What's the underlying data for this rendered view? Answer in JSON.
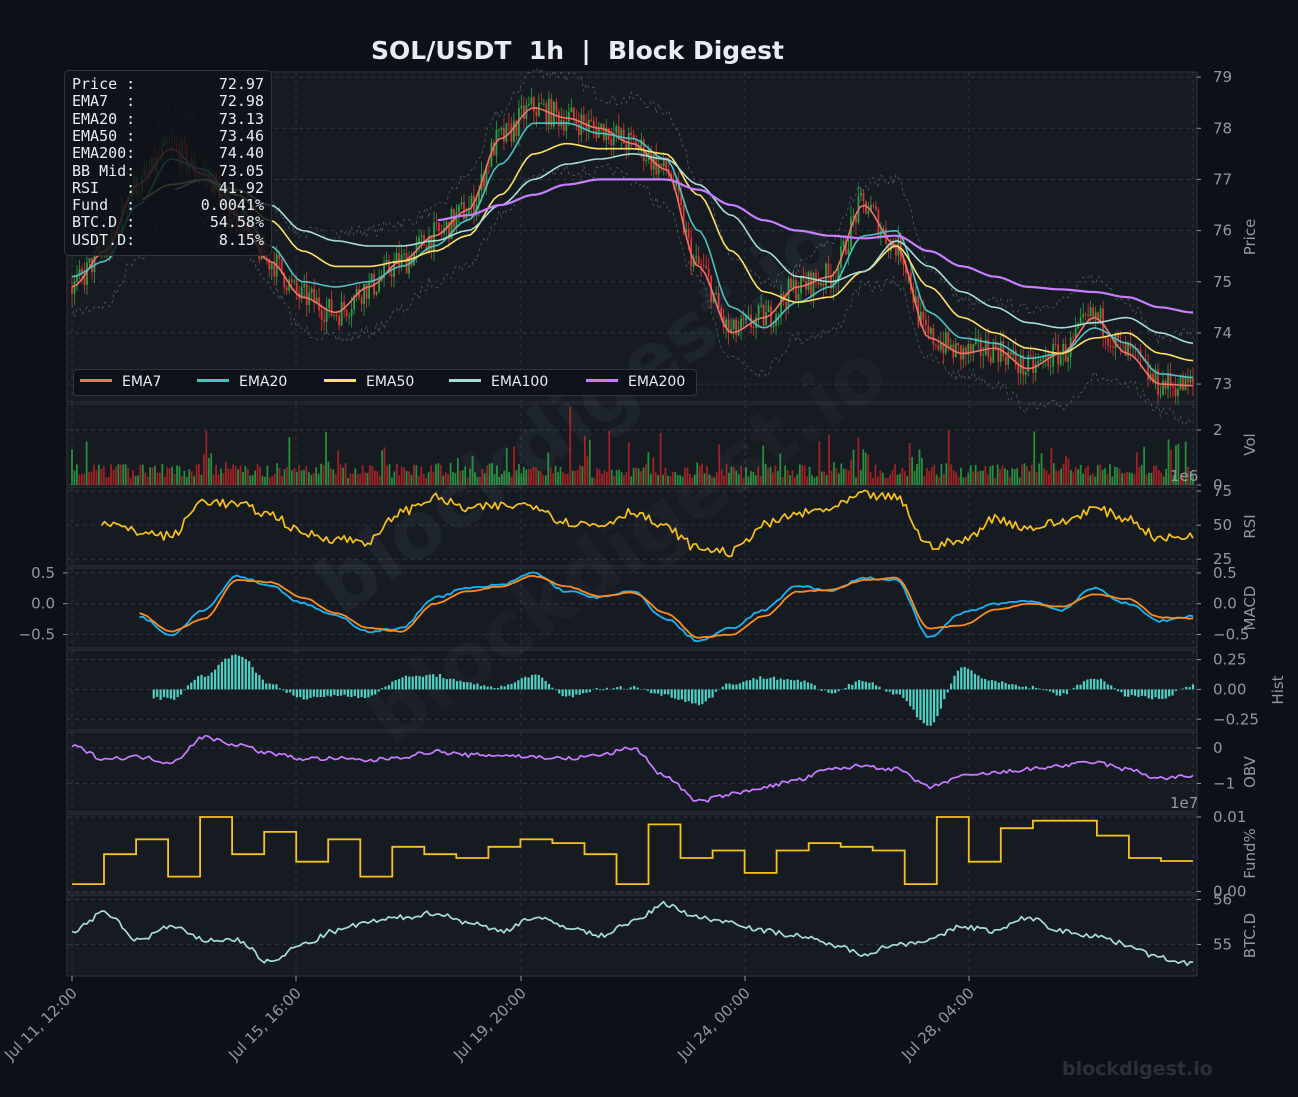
{
  "title": "SOL/USDT  1h  |  Block Digest",
  "footer": "blockdigest.io",
  "watermark": "blockdigest.io",
  "colors": {
    "background": "#0d1117",
    "panel": "#161b22",
    "grid": "#30363d",
    "text": "#e6edf3",
    "muted": "#9198a1",
    "up": "#2ea043",
    "down": "#da3633",
    "ema7": "#f0736a",
    "ema20": "#4cc2c0",
    "ema50": "#ffe066",
    "ema100": "#a8dbd8",
    "ema200": "#c77dff",
    "rsi": "#f7c21b",
    "macd": "#1ab3f2",
    "signal": "#ff8c1a",
    "hist": "#4fd1c5",
    "obv": "#c77dff",
    "funding": "#f7c21b",
    "btcd": "#a8dbd8"
  },
  "info_box": [
    {
      "key": "Price :",
      "value": "72.97"
    },
    {
      "key": "EMA7  :",
      "value": "72.98"
    },
    {
      "key": "EMA20 :",
      "value": "73.13"
    },
    {
      "key": "EMA50 :",
      "value": "73.46"
    },
    {
      "key": "EMA200:",
      "value": "74.40"
    },
    {
      "key": "BB Mid:",
      "value": "73.05"
    },
    {
      "key": "RSI   :",
      "value": "41.92"
    },
    {
      "key": "Fund  :",
      "value": "0.0041%"
    },
    {
      "key": "BTC.D :",
      "value": "54.58%"
    },
    {
      "key": "USDT.D:",
      "value": "8.15%"
    }
  ],
  "legend": [
    {
      "label": "EMA7",
      "color": "#f0736a"
    },
    {
      "label": "EMA20",
      "color": "#4cc2c0"
    },
    {
      "label": "EMA50",
      "color": "#ffe066"
    },
    {
      "label": "EMA100",
      "color": "#a8dbd8"
    },
    {
      "label": "EMA200",
      "color": "#c77dff"
    }
  ],
  "chart_data": {
    "type": "line",
    "title": "SOL/USDT  1h  |  Block Digest",
    "x_labels": [
      "Jul 11, 12:00",
      "Jul 15, 16:00",
      "Jul 19, 20:00",
      "Jul 24, 00:00",
      "Jul 28, 04:00"
    ],
    "panels": [
      {
        "name": "price",
        "ylabel": "Price",
        "yticks": [
          73,
          74,
          75,
          76,
          77,
          78,
          79
        ],
        "ylim": [
          72.65,
          79.1
        ],
        "candles": "hourly OHLC candles",
        "series": [
          {
            "name": "EMA7",
            "values": [
              74.9,
              75.6,
              76.9,
              77.6,
              77.1,
              76.3,
              75.4,
              74.7,
              74.4,
              74.9,
              75.4,
              75.9,
              76.4,
              77.8,
              78.4,
              78.2,
              78.0,
              77.7,
              77.2,
              75.3,
              74.0,
              74.3,
              74.9,
              75.1,
              76.5,
              75.7,
              73.9,
              73.6,
              73.7,
              73.3,
              73.6,
              74.3,
              73.6,
              73.0,
              72.97
            ]
          },
          {
            "name": "EMA20",
            "values": [
              75.1,
              75.4,
              76.5,
              77.4,
              77.2,
              76.5,
              75.7,
              75.0,
              74.9,
              75.0,
              75.3,
              75.7,
              76.2,
              77.3,
              78.1,
              78.1,
              77.9,
              77.8,
              77.4,
              76.0,
              74.5,
              74.1,
              74.6,
              74.9,
              75.9,
              76.0,
              74.4,
              73.9,
              73.8,
              73.5,
              73.6,
              74.1,
              73.8,
              73.2,
              73.13
            ]
          },
          {
            "name": "EMA50",
            "values": [
              null,
              null,
              76.6,
              76.9,
              77.0,
              76.7,
              76.2,
              75.6,
              75.3,
              75.3,
              75.4,
              75.6,
              75.9,
              76.7,
              77.5,
              77.7,
              77.6,
              77.6,
              77.5,
              76.7,
              75.6,
              74.8,
              74.6,
              74.7,
              75.2,
              75.7,
              74.9,
              74.3,
              74.0,
              73.7,
              73.6,
              73.9,
              74.0,
              73.6,
              73.46
            ]
          },
          {
            "name": "EMA100",
            "values": [
              null,
              null,
              null,
              76.8,
              77.0,
              76.8,
              76.5,
              76.0,
              75.8,
              75.7,
              75.7,
              75.8,
              76.0,
              76.5,
              77.0,
              77.3,
              77.4,
              77.5,
              77.4,
              76.9,
              76.3,
              75.6,
              75.1,
              75.0,
              75.2,
              75.8,
              75.3,
              74.8,
              74.5,
              74.2,
              74.1,
              74.2,
              74.3,
              74.0,
              73.8
            ]
          },
          {
            "name": "EMA200",
            "values": [
              null,
              null,
              null,
              null,
              null,
              null,
              null,
              null,
              null,
              null,
              null,
              76.2,
              76.3,
              76.5,
              76.7,
              76.9,
              77.0,
              77.0,
              77.0,
              76.8,
              76.5,
              76.2,
              76.0,
              75.9,
              75.85,
              75.9,
              75.6,
              75.3,
              75.1,
              74.9,
              74.85,
              74.8,
              74.7,
              74.5,
              74.4
            ]
          }
        ]
      },
      {
        "name": "volume",
        "ylabel": "Vol",
        "multiplier": "1e6",
        "yticks": [
          0,
          2
        ],
        "ylim": [
          0,
          2.95
        ]
      },
      {
        "name": "rsi",
        "ylabel": "RSI",
        "yticks": [
          25,
          50,
          75
        ],
        "ylim": [
          20,
          78
        ],
        "series": [
          {
            "name": "RSI",
            "values": [
              35,
              52,
              45,
              42,
              68,
              65,
              58,
              44,
              40,
              38,
              60,
              70,
              62,
              64,
              65,
              52,
              50,
              60,
              48,
              33,
              30,
              50,
              58,
              62,
              72,
              70,
              35,
              38,
              55,
              48,
              52,
              62,
              55,
              40,
              41.92
            ]
          }
        ]
      },
      {
        "name": "macd",
        "ylabel": "MACD",
        "yticks": [
          -0.5,
          0.0,
          0.5
        ],
        "ylim": [
          -0.72,
          0.58
        ],
        "series": [
          {
            "name": "MACD",
            "values": [
              -0.25,
              0.0,
              -0.2,
              -0.5,
              -0.1,
              0.45,
              0.3,
              0.0,
              -0.2,
              -0.45,
              -0.4,
              0.1,
              0.25,
              0.3,
              0.5,
              0.2,
              0.1,
              0.2,
              -0.25,
              -0.6,
              -0.4,
              -0.1,
              0.3,
              0.2,
              0.42,
              0.38,
              -0.55,
              -0.15,
              0.0,
              0.05,
              -0.1,
              0.25,
              0.0,
              -0.28,
              -0.2
            ]
          },
          {
            "name": "Signal",
            "values": [
              null,
              -0.05,
              -0.15,
              -0.45,
              -0.25,
              0.38,
              0.35,
              0.1,
              -0.15,
              -0.4,
              -0.45,
              0.0,
              0.2,
              0.28,
              0.45,
              0.28,
              0.12,
              0.18,
              -0.15,
              -0.55,
              -0.5,
              -0.2,
              0.2,
              0.22,
              0.38,
              0.42,
              -0.4,
              -0.35,
              -0.1,
              0.0,
              -0.05,
              0.15,
              0.08,
              -0.22,
              -0.24
            ]
          }
        ]
      },
      {
        "name": "hist",
        "ylabel": "Hist",
        "yticks": [
          -0.25,
          0.0,
          0.25
        ],
        "ylim": [
          -0.34,
          0.33
        ],
        "series": [
          {
            "name": "Hist",
            "values": [
              null,
              null,
              -0.05,
              -0.08,
              0.12,
              0.3,
              0.05,
              -0.08,
              -0.05,
              -0.06,
              0.1,
              0.12,
              0.05,
              0.02,
              0.12,
              -0.06,
              0.0,
              0.02,
              -0.05,
              -0.12,
              0.05,
              0.1,
              0.08,
              -0.03,
              0.08,
              -0.04,
              -0.3,
              0.18,
              0.06,
              0.02,
              -0.04,
              0.1,
              -0.05,
              -0.08,
              0.03
            ]
          }
        ]
      },
      {
        "name": "obv",
        "ylabel": "OBV",
        "multiplier": "1e7",
        "yticks": [
          -1,
          0
        ],
        "ylim": [
          -1.8,
          0.45
        ],
        "series": [
          {
            "name": "OBV",
            "values": [
              0.05,
              -0.3,
              -0.25,
              -0.4,
              0.3,
              0.1,
              -0.15,
              -0.3,
              -0.3,
              -0.35,
              -0.25,
              -0.1,
              -0.2,
              -0.2,
              -0.25,
              -0.3,
              -0.2,
              0.0,
              -0.8,
              -1.5,
              -1.3,
              -1.1,
              -0.9,
              -0.6,
              -0.5,
              -0.6,
              -1.1,
              -0.8,
              -0.7,
              -0.6,
              -0.5,
              -0.4,
              -0.6,
              -0.85,
              -0.8
            ]
          }
        ]
      },
      {
        "name": "funding",
        "ylabel": "Fund%",
        "yticks": [
          "0.00",
          "0.01"
        ],
        "ylim": [
          -0.0002,
          0.0104
        ],
        "series": [
          {
            "name": "Funding",
            "values": [
              0.001,
              0.005,
              0.007,
              0.002,
              0.01,
              0.005,
              0.008,
              0.004,
              0.007,
              0.002,
              0.006,
              0.005,
              0.0045,
              0.006,
              0.007,
              0.0065,
              0.005,
              0.001,
              0.009,
              0.0045,
              0.0055,
              0.0025,
              0.0055,
              0.0065,
              0.006,
              0.0055,
              0.001,
              0.01,
              0.004,
              0.0085,
              0.0095,
              0.0095,
              0.0075,
              0.0045,
              0.0041
            ]
          }
        ]
      },
      {
        "name": "btcd",
        "ylabel": "BTC.D",
        "yticks": [
          55,
          56
        ],
        "ylim": [
          54.3,
          56.1
        ],
        "series": [
          {
            "name": "BTC.D",
            "values": [
              55.3,
              55.7,
              55.1,
              55.4,
              55.1,
              55.1,
              54.6,
              55.0,
              55.3,
              55.5,
              55.6,
              55.7,
              55.5,
              55.3,
              55.6,
              55.4,
              55.2,
              55.5,
              55.9,
              55.6,
              55.5,
              55.3,
              55.2,
              55.0,
              54.8,
              55.0,
              55.1,
              55.4,
              55.3,
              55.6,
              55.3,
              55.2,
              55.0,
              54.7,
              54.58
            ]
          }
        ]
      }
    ]
  }
}
